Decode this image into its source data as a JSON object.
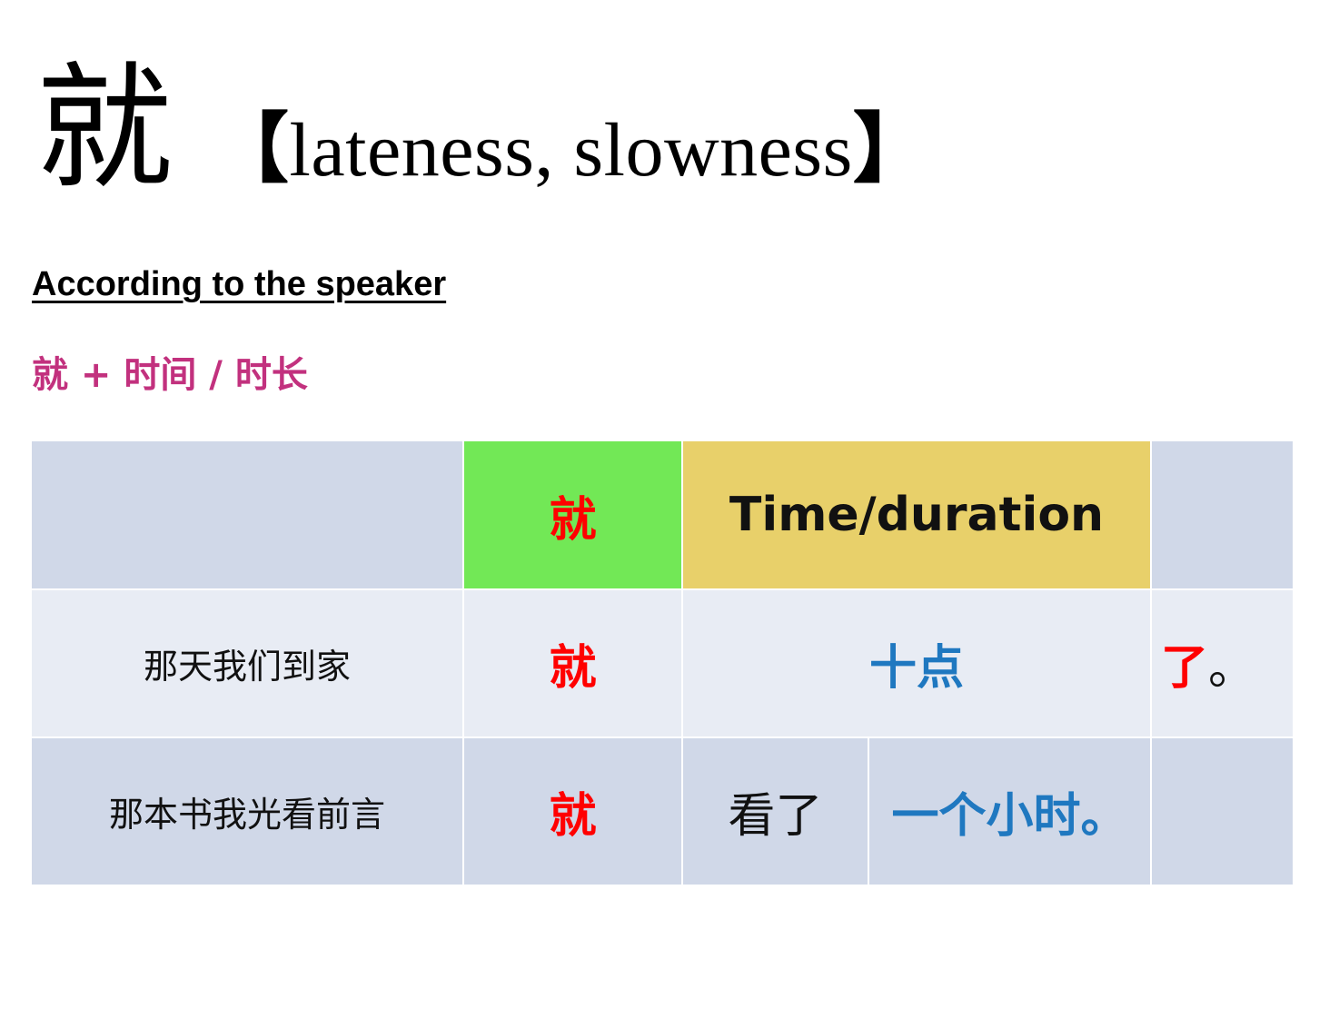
{
  "title": {
    "character": "就",
    "gloss_open": "【",
    "gloss_text": "lateness, slowness",
    "gloss_close": "】"
  },
  "subtitle": "According to the speaker",
  "pattern": "就 + 时间 / 时长",
  "table": {
    "header": {
      "col1": "",
      "col2": "就",
      "col3": "Time/duration",
      "col4": ""
    },
    "row1": {
      "subject": "那天我们到家",
      "jiu": "就",
      "time": "十点",
      "particle": "了",
      "punct": "。"
    },
    "row2": {
      "subject": "那本书我光看前言",
      "jiu": "就",
      "verb": "看了",
      "duration": "一个小时。",
      "tail": ""
    }
  },
  "colors": {
    "pattern": "#c2317e",
    "jiu_highlight": "#ff0000",
    "time_text": "#1f78c0",
    "header_jiu_bg": "#72e856",
    "header_time_bg": "#e8d06a",
    "row_dark_bg": "#d0d8e8",
    "row_light_bg": "#e8ecf4"
  }
}
